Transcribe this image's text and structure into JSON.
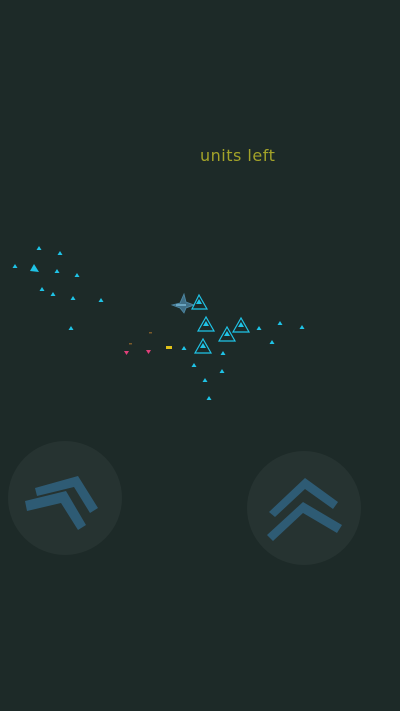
{
  "hud": {
    "units_label": "units left"
  },
  "colors": {
    "background": "#1d2a28",
    "hud_text": "#a3a329",
    "friendly_unit": "#1fc3e6",
    "player_ship": "#3f6e86",
    "enemy_unit": "#e0407a",
    "projectile": "#e0c21a",
    "joystick_bg": "#263331",
    "joystick_chevron": "#2e5b74"
  },
  "controls": {
    "left_joystick": {
      "icon": "chevron-left-icon"
    },
    "right_joystick": {
      "icon": "chevron-up-icon"
    }
  }
}
